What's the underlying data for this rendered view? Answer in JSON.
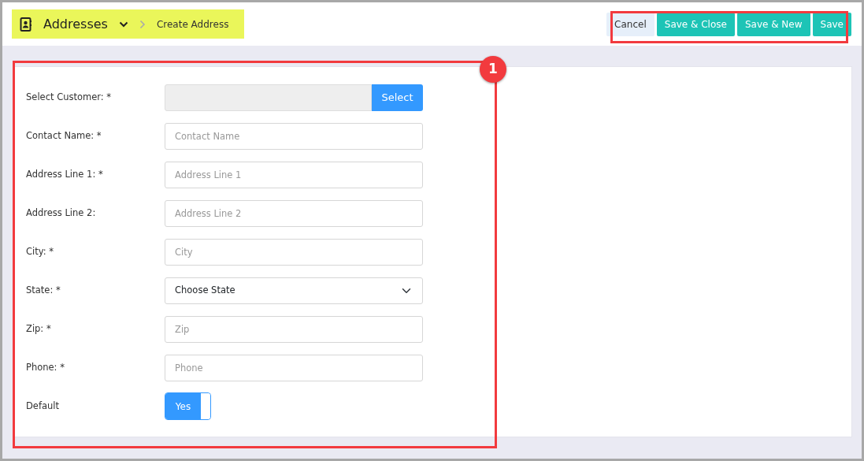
{
  "header": {
    "title": "Addresses",
    "breadcrumb": "Create Address",
    "highlighted": true
  },
  "actions": [
    {
      "label": "Cancel",
      "kind": "secondary"
    },
    {
      "label": "Save & Close",
      "kind": "primary"
    },
    {
      "label": "Save & New",
      "kind": "primary"
    },
    {
      "label": "Save",
      "kind": "primary"
    }
  ],
  "annotation": {
    "badge": "1"
  },
  "fields": [
    {
      "label": "Select Customer: *",
      "kind": "lookup",
      "button": "Select"
    },
    {
      "label": "Contact Name: *",
      "kind": "text",
      "placeholder": "Contact Name"
    },
    {
      "label": "Address Line 1: *",
      "kind": "text",
      "placeholder": "Address Line 1"
    },
    {
      "label": "Address Line 2:",
      "kind": "text",
      "placeholder": "Address Line 2"
    },
    {
      "label": "City: *",
      "kind": "text",
      "placeholder": "City"
    },
    {
      "label": "State: *",
      "kind": "select",
      "value": "Choose State"
    },
    {
      "label": "Zip: *",
      "kind": "text",
      "placeholder": "Zip"
    },
    {
      "label": "Phone: *",
      "kind": "text",
      "placeholder": "Phone"
    },
    {
      "label": "Default",
      "kind": "toggle",
      "on": true,
      "text": "Yes"
    }
  ]
}
